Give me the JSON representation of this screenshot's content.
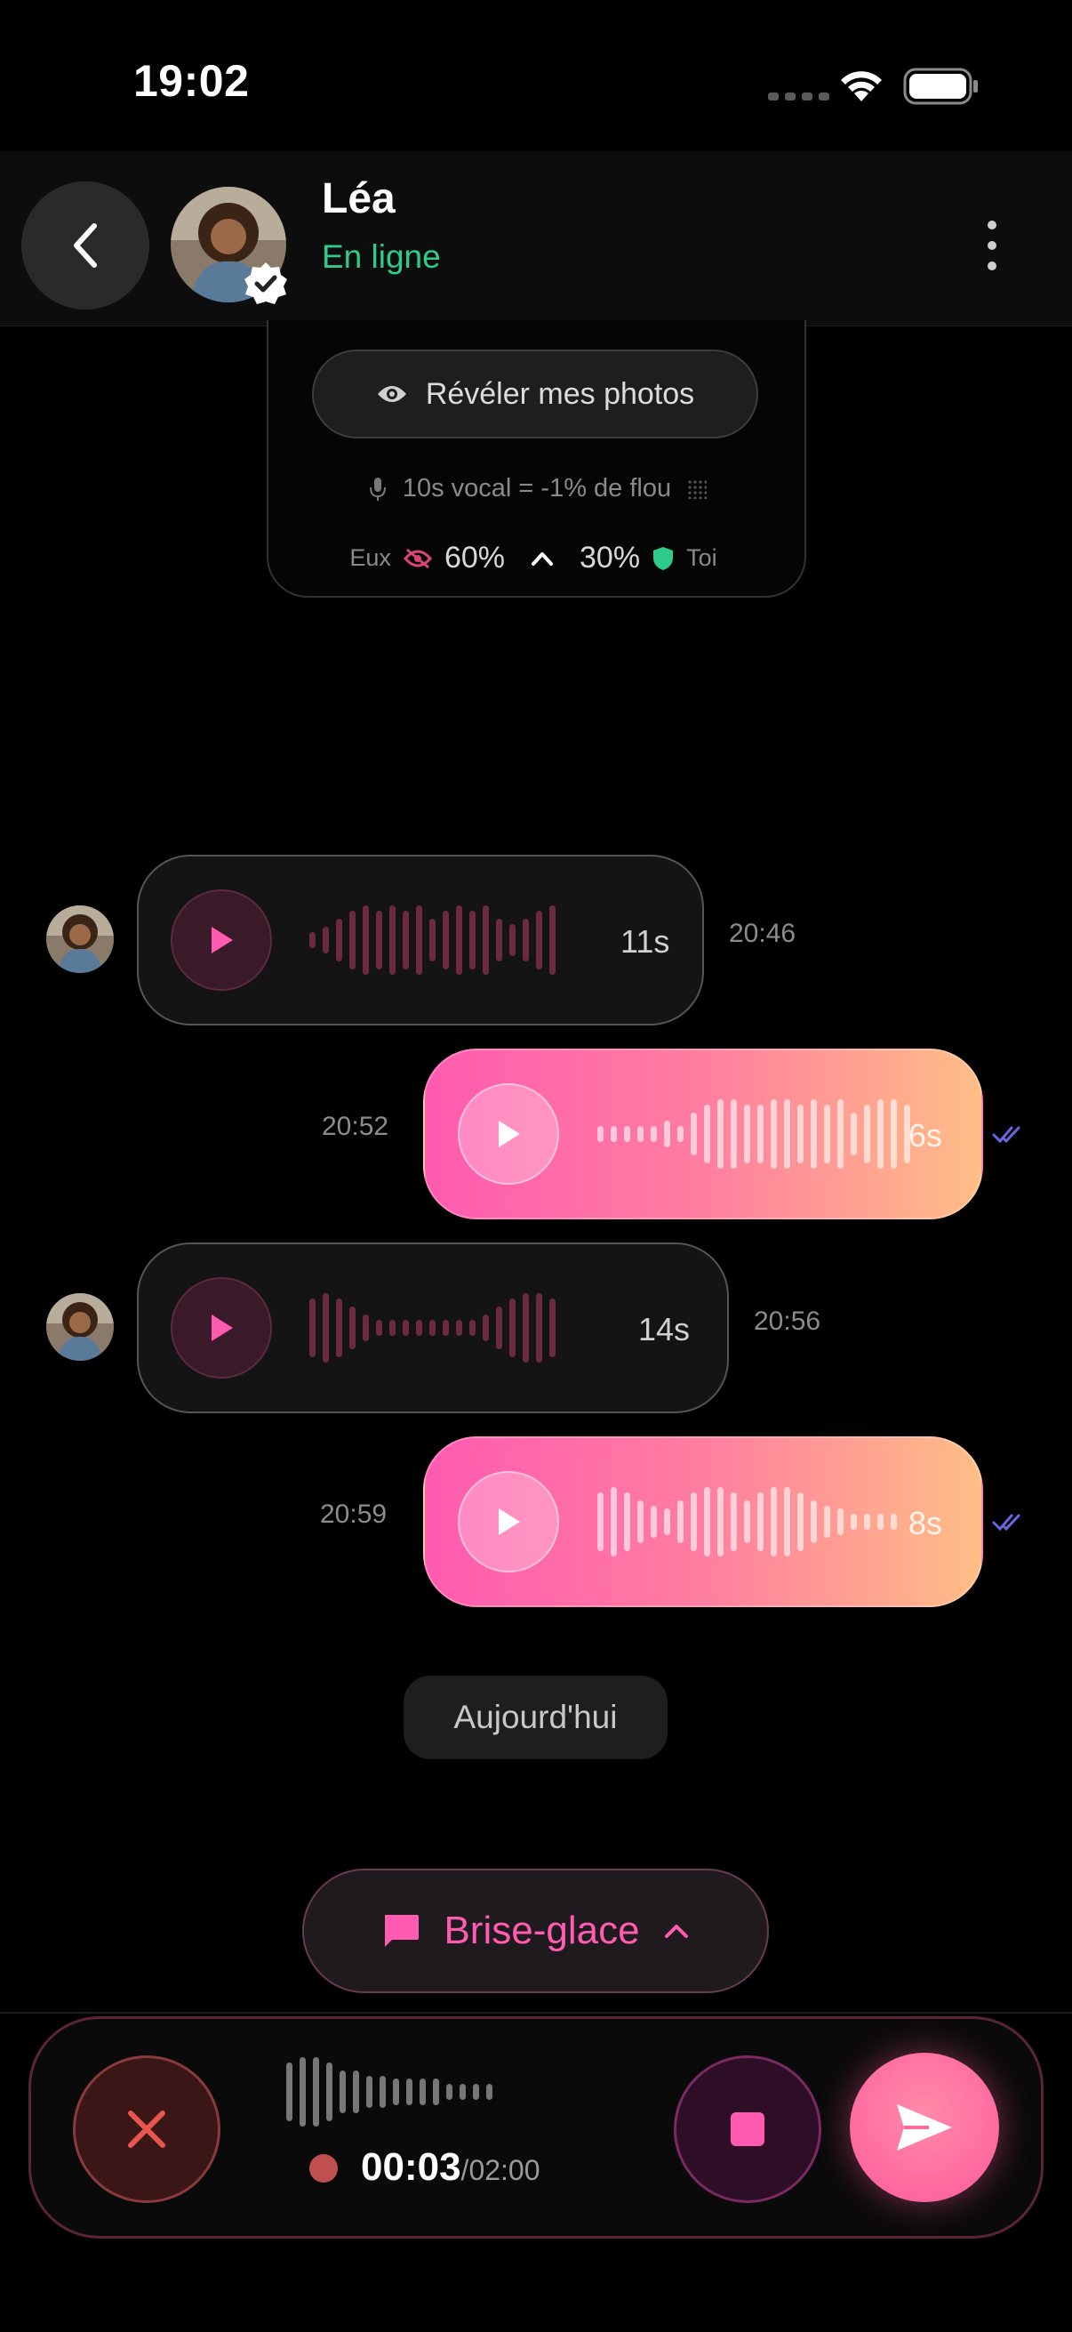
{
  "status_bar": {
    "time": "19:02"
  },
  "header": {
    "back_icon": "chevron-left-icon",
    "contact_name": "Léa",
    "presence": "En ligne",
    "presence_color": "#2ecc8a",
    "more_icon": "more-vertical-icon"
  },
  "reveal": {
    "button_label": "Révéler mes photos",
    "button_icon": "eye-icon",
    "hint": "10s vocal = -1% de flou",
    "them_label": "Eux",
    "them_value": "60%",
    "you_value": "30%",
    "you_label": "Toi"
  },
  "messages": [
    {
      "direction": "in",
      "duration": "11s",
      "time": "20:46",
      "wave": [
        3,
        5,
        8,
        11,
        13,
        11,
        13,
        11,
        13,
        8,
        11,
        13,
        11,
        13,
        8,
        6,
        8,
        11,
        13
      ]
    },
    {
      "direction": "out",
      "duration": "6s",
      "time": "20:52",
      "wave": [
        3,
        3,
        3,
        3,
        3,
        5,
        3,
        8,
        11,
        13,
        13,
        11,
        11,
        13,
        13,
        11,
        13,
        11,
        13,
        8,
        11,
        13,
        13,
        11
      ]
    },
    {
      "direction": "in",
      "duration": "14s",
      "time": "20:56",
      "wave": [
        11,
        13,
        11,
        8,
        5,
        3,
        3,
        3,
        3,
        3,
        3,
        3,
        3,
        5,
        8,
        11,
        13,
        13,
        11
      ]
    },
    {
      "direction": "out",
      "duration": "8s",
      "time": "20:59",
      "wave": [
        11,
        13,
        11,
        8,
        6,
        5,
        8,
        11,
        13,
        13,
        11,
        8,
        11,
        13,
        13,
        11,
        8,
        6,
        5,
        3,
        3,
        3,
        3
      ]
    }
  ],
  "day_separator": "Aujourd'hui",
  "icebreaker": {
    "label": "Brise-glace",
    "icon": "chat-bubble-icon",
    "chevron": "chevron-up-icon"
  },
  "recorder": {
    "elapsed": "00:03",
    "total": "/02:00",
    "wave": [
      11,
      13,
      13,
      11,
      8,
      8,
      6,
      6,
      5,
      5,
      5,
      5,
      3,
      3,
      3,
      3
    ]
  },
  "colors": {
    "accent_pink": "#ff5bb0",
    "bubble_gradient_end": "#ffbe86",
    "read_ticks": "#6a66e0"
  }
}
